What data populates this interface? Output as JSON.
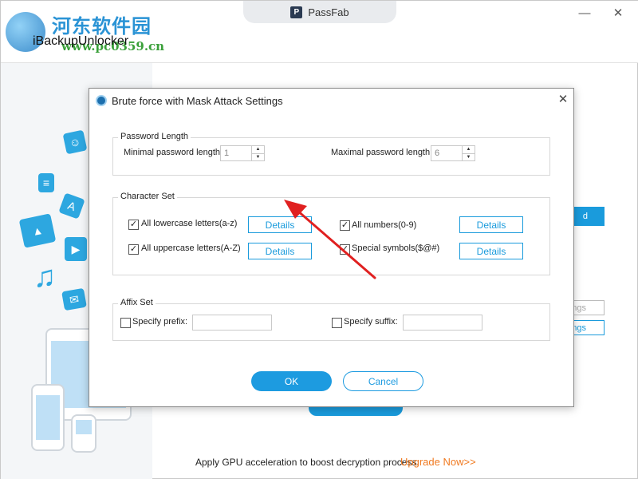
{
  "window": {
    "title": "PassFab",
    "app_name": "iBackupUnlocker",
    "watermark_text": "河东软件园",
    "watermark_url": "www.pc0359.cn"
  },
  "background": {
    "partial_button_1": "d",
    "partial_button_2": "ngs",
    "partial_button_3": "ngs",
    "footer_text": "Apply GPU acceleration to boost decryption process.",
    "upgrade_link": "Upgrade Now>>"
  },
  "dialog": {
    "title": "Brute force with Mask Attack Settings",
    "password_length": {
      "title": "Password Length",
      "min_label": "Minimal password length",
      "min_value": "1",
      "max_label": "Maximal password length",
      "max_value": "6"
    },
    "character_set": {
      "title": "Character Set",
      "lowercase_label": "All lowercase letters(a-z)",
      "uppercase_label": "All uppercase letters(A-Z)",
      "numbers_label": "All numbers(0-9)",
      "symbols_label": "Special symbols($@#)",
      "lowercase_checked": true,
      "uppercase_checked": true,
      "numbers_checked": true,
      "symbols_checked": true,
      "details_label": "Details"
    },
    "affix_set": {
      "title": "Affix Set",
      "prefix_label": "Specify prefix:",
      "suffix_label": "Specify suffix:",
      "prefix_value": "",
      "suffix_value": ""
    },
    "ok_label": "OK",
    "cancel_label": "Cancel"
  },
  "colors": {
    "accent": "#1d9be0",
    "annotation_arrow": "#e02020",
    "upgrade_link": "#f07a21"
  }
}
